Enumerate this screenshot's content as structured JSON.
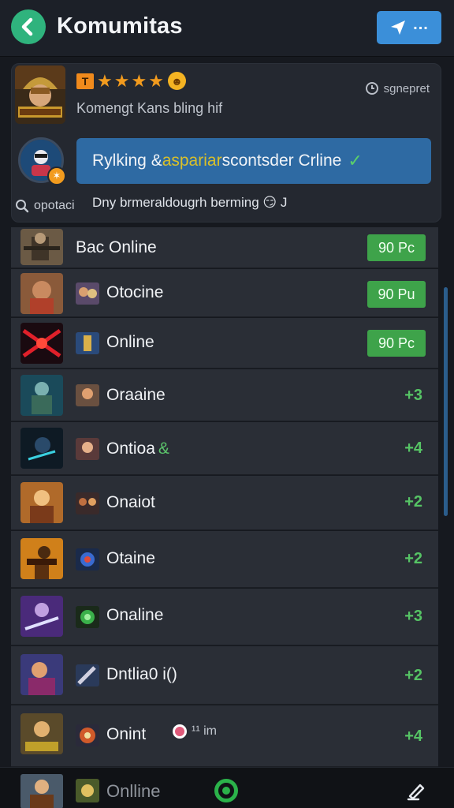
{
  "header": {
    "title": "Komumitas",
    "back_icon": "arrow-left-icon",
    "send_icon": "send-icon",
    "more_label": "..."
  },
  "feature": {
    "badge_letter": "T",
    "stars": 4,
    "subtitle": "Komengt Kans bling hif",
    "time_label": "sgnepret",
    "highlight_prefix": "Rylking & ",
    "highlight_accent": "aspariar",
    "highlight_suffix": " scontsder Crline",
    "search_label": "opotaci",
    "description": "Dny brmeraldougrh berming 😏 J"
  },
  "rows": [
    {
      "name": "Bac Online",
      "side_type": "button",
      "side": "90 Pc"
    },
    {
      "name": "Otocine",
      "side_type": "button",
      "side": "90 Pu"
    },
    {
      "name": "Online",
      "side_type": "button",
      "side": "90 Pc"
    },
    {
      "name": "Oraaine",
      "side_type": "text",
      "side": "+3"
    },
    {
      "name": "Ontioa",
      "extra": "&",
      "side_type": "text",
      "side": "+4"
    },
    {
      "name": "Onaiot",
      "side_type": "text",
      "side": "+2"
    },
    {
      "name": "Otaine",
      "side_type": "text",
      "side": "+2"
    },
    {
      "name": "Onaline",
      "side_type": "text",
      "side": "+3"
    },
    {
      "name": "Dntlia0 i()",
      "side_type": "text",
      "side": "+2"
    },
    {
      "name": "Onint",
      "time": "¹¹ im",
      "side_type": "text",
      "side": "+4"
    }
  ],
  "bottom": {
    "label": "Onlline"
  },
  "colors": {
    "accent_green": "#2fb37d",
    "button_blue": "#3b8fd9",
    "online_green": "#3ea34a"
  }
}
